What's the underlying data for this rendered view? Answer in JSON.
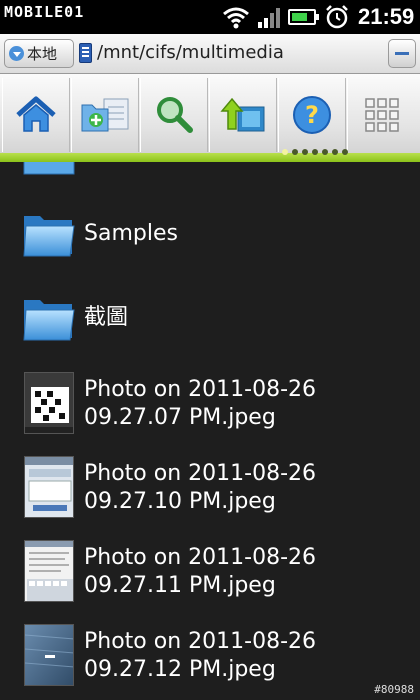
{
  "statusbar": {
    "brand_watermark": "MOBILE01",
    "time": "21:59",
    "battery_level": 0.75,
    "icons": [
      "wifi-icon",
      "signal-icon",
      "battery-icon",
      "alarm-icon"
    ]
  },
  "pathbar": {
    "location_label": "本地",
    "path": "/mnt/cifs/multimedia"
  },
  "toolbar": {
    "buttons": [
      "home-icon",
      "new-folder-icon",
      "search-icon",
      "up-folder-icon",
      "help-icon",
      "grid-menu-icon"
    ],
    "page_count": 7,
    "active_page": 0,
    "accent_color": "#9ccd2a"
  },
  "files": [
    {
      "type": "folder",
      "name": "Samples"
    },
    {
      "type": "folder",
      "name": "截圖"
    },
    {
      "type": "image",
      "name_line1": "Photo on 2011-08-26",
      "name_line2": "09.27.07 PM.jpeg"
    },
    {
      "type": "image",
      "name_line1": "Photo on 2011-08-26",
      "name_line2": "09.27.10 PM.jpeg"
    },
    {
      "type": "image",
      "name_line1": "Photo on 2011-08-26",
      "name_line2": "09.27.11 PM.jpeg"
    },
    {
      "type": "image",
      "name_line1": "Photo on 2011-08-26",
      "name_line2": "09.27.12 PM.jpeg"
    }
  ],
  "watermark_id": "#80988"
}
